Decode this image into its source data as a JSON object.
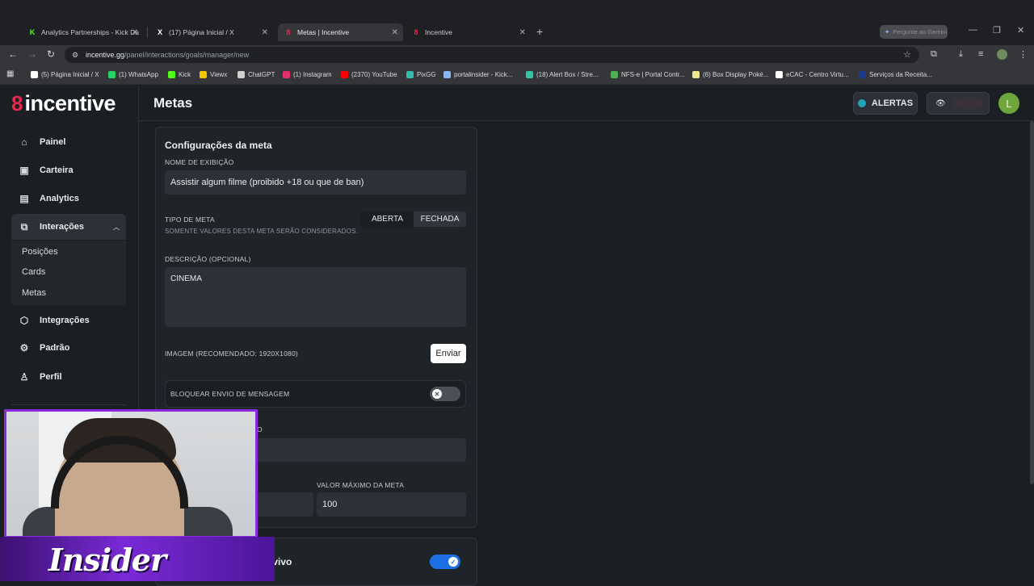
{
  "browser": {
    "tabs": [
      {
        "title": "Analytics Partnerships - Kick Da",
        "icon": "kick-icon"
      },
      {
        "title": "(17) Página Inicial / X",
        "icon": "x-icon"
      },
      {
        "title": "Metas | Incentive",
        "icon": "incentive-icon"
      },
      {
        "title": "Incentive",
        "icon": "incentive-icon"
      }
    ],
    "gemini_label": "Pergunte ao Gemini",
    "url_host": "incentive.gg",
    "url_path": "/panel/interactions/goals/manager/new",
    "bookmarks": [
      {
        "label": "(5) Página Inicial / X",
        "color": "#ffffff"
      },
      {
        "label": "(1) WhatsApp",
        "color": "#25d366"
      },
      {
        "label": "Kick",
        "color": "#53fc18"
      },
      {
        "label": "Viewx",
        "color": "#f5c400"
      },
      {
        "label": "ChatGPT",
        "color": "#d0d0d0"
      },
      {
        "label": "(1) Instagram",
        "color": "#e1306c"
      },
      {
        "label": "(2370) YouTube",
        "color": "#ff0000"
      },
      {
        "label": "PixGG",
        "color": "#32bcad"
      },
      {
        "label": "portalinsider - Kick...",
        "color": "#8ab4f8"
      },
      {
        "label": "(18) Alert Box / Stre...",
        "color": "#31c3a2"
      },
      {
        "label": "NFS-e | Portal Contr...",
        "color": "#4caf50"
      },
      {
        "label": "(6) Box Display Poké...",
        "color": "#f0e68c"
      },
      {
        "label": "eCAC - Centro Virtu...",
        "color": "#ffffff"
      },
      {
        "label": "Serviços da Receita...",
        "color": "#1e3a8a"
      }
    ]
  },
  "app": {
    "logo_text": "incentive",
    "page_title": "Metas",
    "alerts_label": "ALERTAS",
    "user_initial": "L",
    "accent": "#e4294e"
  },
  "sidebar": {
    "items": [
      {
        "label": "Painel",
        "icon": "home-icon"
      },
      {
        "label": "Carteira",
        "icon": "wallet-icon"
      },
      {
        "label": "Analytics",
        "icon": "chart-icon"
      },
      {
        "label": "Interações",
        "icon": "interactions-icon"
      },
      {
        "label": "Integrações",
        "icon": "cube-icon"
      },
      {
        "label": "Padrão",
        "icon": "gear-icon"
      },
      {
        "label": "Perfil",
        "icon": "user-icon"
      }
    ],
    "subitems": [
      "Posições",
      "Cards",
      "Metas"
    ]
  },
  "form": {
    "section_title": "Configurações da meta",
    "display_name_label": "NOME DE EXIBIÇÃO",
    "display_name_value": "Assistir algum filme (proibido +18 ou que de ban)",
    "goal_type_label": "TIPO DE META",
    "goal_type_hint": "SOMENTE VALORES DESTA META SERÃO CONSIDERADOS.",
    "goal_type_options": [
      "ABERTA",
      "FECHADA"
    ],
    "goal_type_selected": "FECHADA",
    "description_label": "DESCRIÇÃO (OPCIONAL)",
    "description_value": "CINEMA",
    "image_label": "IMAGEM (RECOMENDADO: 1920X1080)",
    "send_button": "Enviar",
    "block_message_label": "BLOQUEAR ENVIO DE MENSAGEM",
    "block_message_on": false,
    "partial_label_tail": "O",
    "max_value_label": "VALOR MÁXIMO DA META",
    "max_value": "100",
    "live_label_tail": "ao vivo",
    "live_on": true
  },
  "overlay": {
    "banner_text": "Insider"
  }
}
